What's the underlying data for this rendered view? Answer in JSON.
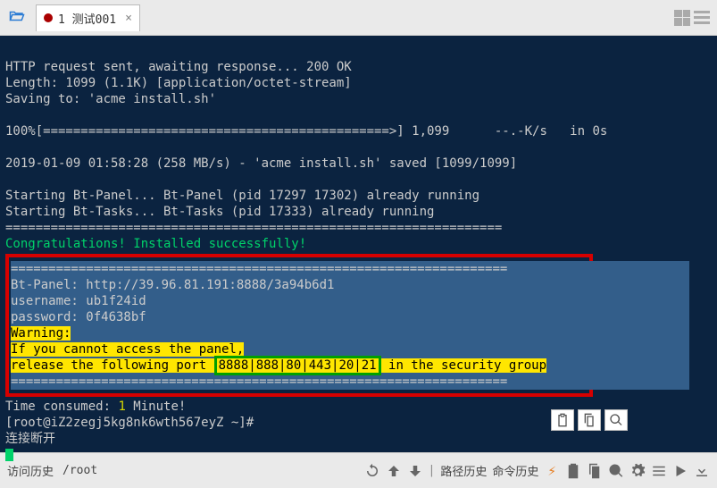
{
  "tab": {
    "label": "1 测试001",
    "close": "×"
  },
  "term": {
    "l1": "HTTP request sent, awaiting response... 200 OK",
    "l2": "Length: 1099 (1.1K) [application/octet-stream]",
    "l3": "Saving to: 'acme install.sh'",
    "l4": "100%[==============================================>] 1,099      --.-K/s   in 0s",
    "l5": "2019-01-09 01:58:28 (258 MB/s) - 'acme install.sh' saved [1099/1099]",
    "l6": "Starting Bt-Panel... Bt-Panel (pid 17297 17302) already running",
    "l7": "Starting Bt-Tasks... Bt-Tasks (pid 17333) already running",
    "l8": "==================================================================",
    "congrats": "Congratulations! Installed successfully!",
    "divider": "==================================================================",
    "panel_url": "Bt-Panel: http://39.96.81.191:8888/3a94b6d1",
    "username": "username: ub1f24id",
    "password": "password: 0f4638bf",
    "warn_label": "Warning:",
    "warn_l1": "If you cannot access the panel,",
    "warn_l2a": "release the following port ",
    "ports": "8888|888|80|443|20|21",
    "warn_l2b": " in the security group",
    "box_bottom": "==================================================================",
    "time_a": "Time consumed: ",
    "time_b": "1",
    "time_c": " Minute!",
    "prompt": "[root@iZ2zegj5kg8nk6wth567eyZ ~]#",
    "disconnect": "连接断开"
  },
  "bottom": {
    "history": "访问历史",
    "path": "/root",
    "path_history": "路径历史",
    "cmd_history": "命令历史"
  }
}
